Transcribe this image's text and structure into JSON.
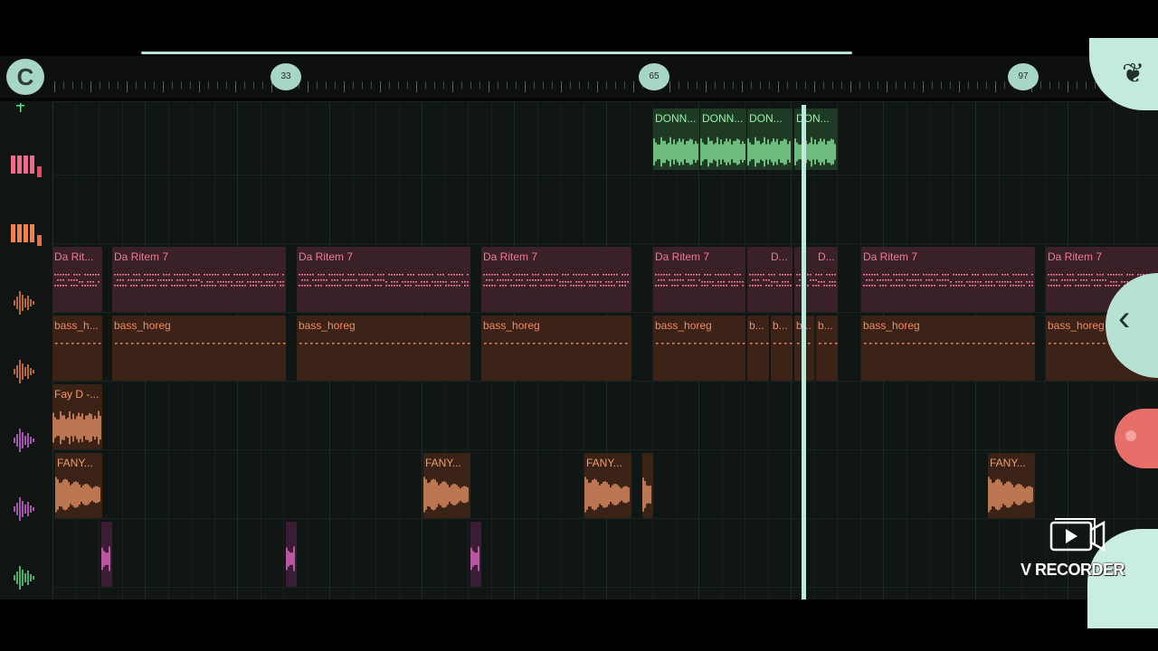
{
  "colors": {
    "accent": "#a7d6c7",
    "pattern_clip": "#f27891",
    "bass_clip": "#f08a60",
    "audio_orange": "#f39a6a",
    "audio_green": "#8ff5a4",
    "audio_pink": "#f06fd0"
  },
  "ruler": {
    "markers": [
      "33",
      "65",
      "97"
    ]
  },
  "logo_glyph": "C",
  "track_icons": [
    "stepper-icon",
    "piano-roll-icon",
    "piano-roll-icon",
    "audio-waveform-icon",
    "audio-waveform-icon",
    "audio-waveform-icon",
    "audio-waveform-icon",
    "audio-waveform-icon"
  ],
  "clips": {
    "donn_1": "DONN...",
    "donn_2": "DONN...",
    "don_3": "DON...",
    "don_4": "DON...",
    "ritem_short": "Da Rit...",
    "ritem": "Da Ritem 7",
    "ritem_d": "D...",
    "bass_short": "bass_h...",
    "bass": "bass_horeg",
    "bass_b": "b...",
    "fay": "Fay D -...",
    "fany": "FANY..."
  },
  "fab_glyph": "‹",
  "watermark": {
    "text": "V RECORDER",
    "icon": "video-play-icon"
  }
}
